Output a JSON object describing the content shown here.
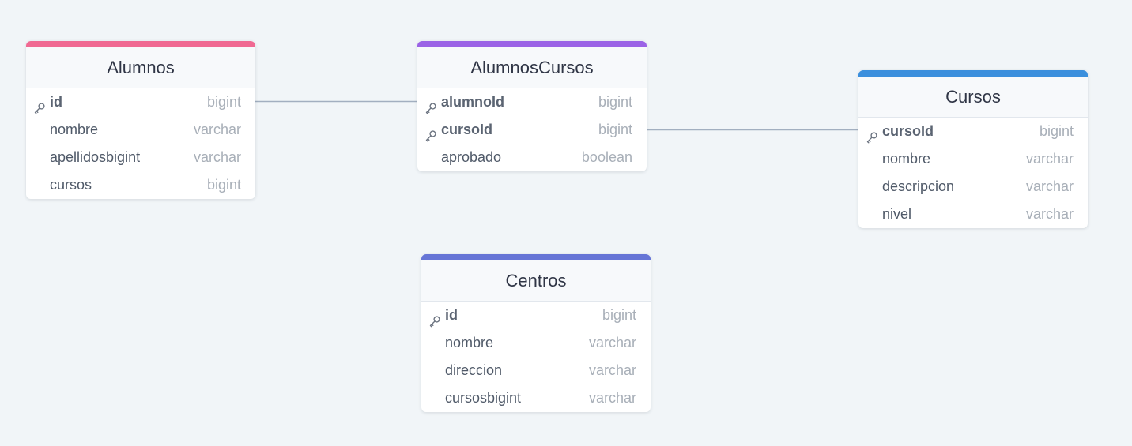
{
  "tables": {
    "alumnos": {
      "name": "Alumnos",
      "color": "#f06992",
      "fields": [
        {
          "name": "id",
          "type": "bigint",
          "pk": true
        },
        {
          "name": "nombre",
          "type": "varchar",
          "pk": false
        },
        {
          "name": "apellidosbigint",
          "type": "varchar",
          "pk": false
        },
        {
          "name": "cursos",
          "type": "bigint",
          "pk": false
        }
      ]
    },
    "alumnoscursos": {
      "name": "AlumnosCursos",
      "color": "#9b63e6",
      "fields": [
        {
          "name": "alumnoId",
          "type": "bigint",
          "pk": true
        },
        {
          "name": "cursoId",
          "type": "bigint",
          "pk": true
        },
        {
          "name": "aprobado",
          "type": "boolean",
          "pk": false
        }
      ]
    },
    "cursos": {
      "name": "Cursos",
      "color": "#3b8fdd",
      "fields": [
        {
          "name": "cursoId",
          "type": "bigint",
          "pk": true
        },
        {
          "name": "nombre",
          "type": "varchar",
          "pk": false
        },
        {
          "name": "descripcion",
          "type": "varchar",
          "pk": false
        },
        {
          "name": "nivel",
          "type": "varchar",
          "pk": false
        }
      ]
    },
    "centros": {
      "name": "Centros",
      "color": "#6675d6",
      "fields": [
        {
          "name": "id",
          "type": "bigint",
          "pk": true
        },
        {
          "name": "nombre",
          "type": "varchar",
          "pk": false
        },
        {
          "name": "direccion",
          "type": "varchar",
          "pk": false
        },
        {
          "name": "cursosbigint",
          "type": "varchar",
          "pk": false
        }
      ]
    }
  },
  "relationships": [
    {
      "from": "alumnos.id",
      "to": "alumnoscursos.alumnoId"
    },
    {
      "from": "alumnoscursos.cursoId",
      "to": "cursos.cursoId"
    }
  ],
  "colors": {
    "background": "#f1f5f8",
    "edge": "#a2afc0",
    "key_icon": "#6b7380"
  },
  "icons": {
    "primary_key": "key-icon"
  }
}
